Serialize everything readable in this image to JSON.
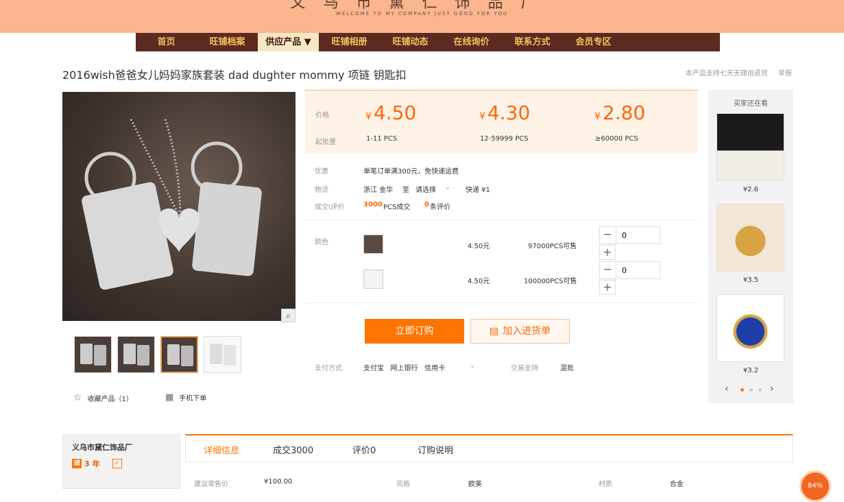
{
  "header": {
    "shop_name": "义乌市黛仁饰品厂",
    "slogan": "WELCOME TO MY COMPANY JUST GOOD FOR YOU"
  },
  "nav": {
    "items": [
      "首页",
      "旺铺档案",
      "供应产品 ▼",
      "旺铺相册",
      "旺铺动态",
      "在线询价",
      "联系方式",
      "会员专区"
    ],
    "active_index": 2
  },
  "product": {
    "title": "2016wish爸爸女儿妈妈家族套装 dad dughter mommy 项链 钥匙扣",
    "return_note": "本产品支持七天无理由退货",
    "report": "举报"
  },
  "pricing": {
    "price_label": "价格",
    "moq_label": "起批量",
    "currency": "¥",
    "tiers": [
      {
        "price": "4.50",
        "qty": "1-11 PCS"
      },
      {
        "price": "4.30",
        "qty": "12-59999 PCS"
      },
      {
        "price": "2.80",
        "qty": "≥60000 PCS"
      }
    ]
  },
  "info": {
    "promo_label": "优惠",
    "promo_value": "单笔订单满300元，免快递运费",
    "logistics_label": "物流",
    "logistics_from": "浙江 金华",
    "logistics_to_word": "至",
    "logistics_select": "请选择",
    "logistics_fee": "快递 ¥1",
    "deals_label": "成交\\评价",
    "deals_count": "3000",
    "deals_unit": "PCS成交",
    "reviews_count": "0",
    "reviews_unit": "条评价"
  },
  "sku": {
    "label": "颜色",
    "rows": [
      {
        "price": "4.50元",
        "stock": "97000PCS可售",
        "qty": "0"
      },
      {
        "price": "4.50元",
        "stock": "100000PCS可售",
        "qty": "0"
      }
    ]
  },
  "actions": {
    "buy": "立即订购",
    "cart": "加入进货单"
  },
  "payment": {
    "label": "支付方式",
    "methods": "支付宝   网上银行   信用卡",
    "support_label": "交易支持",
    "support_value": "混批"
  },
  "gallery": {
    "fav": "收藏产品（1）",
    "mobile": "手机下单"
  },
  "sidebar": {
    "title": "买家还在看",
    "items": [
      {
        "price": "¥2.6"
      },
      {
        "price": "¥3.5"
      },
      {
        "price": "¥3.2"
      }
    ]
  },
  "company": {
    "name": "义乌市黛仁饰品厂",
    "years": "3",
    "years_unit": "年"
  },
  "tabs": {
    "items": [
      "详细信息",
      "成交3000",
      "评价0",
      "订购说明"
    ]
  },
  "attributes": [
    {
      "k": "建议零售价",
      "v": "¥100.00"
    },
    {
      "k": "风格",
      "v": "欧美"
    },
    {
      "k": "材质",
      "v": "合金"
    }
  ],
  "float": {
    "label": "84%"
  },
  "colors": {
    "accent": "#ff7300",
    "nav_bg": "#5b2a20",
    "nav_text": "#f5c15b",
    "banner": "#fbb58f"
  }
}
